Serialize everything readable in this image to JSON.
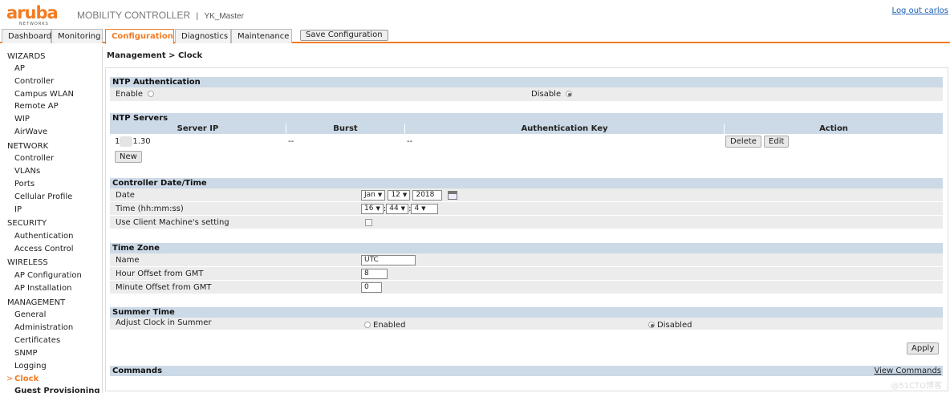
{
  "header": {
    "logo_text": "aruba",
    "logo_sub": "NETWORKS",
    "product": "MOBILITY CONTROLLER",
    "separator": "|",
    "host": "YK_Master",
    "logout": "Log out carlos"
  },
  "tabs": [
    "Dashboard",
    "Monitoring",
    "Configuration",
    "Diagnostics",
    "Maintenance"
  ],
  "save_button": "Save Configuration",
  "sidebar": {
    "wizards": "WIZARDS",
    "wizards_items": [
      "AP",
      "Controller",
      "Campus WLAN",
      "Remote AP",
      "WIP",
      "AirWave"
    ],
    "network": "NETWORK",
    "network_items": [
      "Controller",
      "VLANs",
      "Ports",
      "Cellular Profile",
      "IP"
    ],
    "security": "SECURITY",
    "security_items": [
      "Authentication",
      "Access Control"
    ],
    "wireless": "WIRELESS",
    "wireless_items": [
      "AP Configuration",
      "AP Installation"
    ],
    "management": "MANAGEMENT",
    "management_items": [
      "General",
      "Administration",
      "Certificates",
      "SNMP",
      "Logging",
      "Clock",
      "Guest Provisioning"
    ],
    "active_marker": ">"
  },
  "breadcrumb": "Management > Clock",
  "ntp_auth": {
    "title": "NTP Authentication",
    "enable_label": "Enable",
    "disable_label": "Disable",
    "selected": "Disable"
  },
  "ntp_servers": {
    "title": "NTP Servers",
    "columns": [
      "Server IP",
      "Burst",
      "Authentication Key",
      "Action"
    ],
    "rows": [
      {
        "server_ip_prefix": "1",
        "server_ip_suffix": "1.30",
        "burst": "--",
        "auth_key": "--",
        "delete": "Delete",
        "edit": "Edit"
      }
    ],
    "new_button": "New"
  },
  "datetime": {
    "title": "Controller Date/Time",
    "date_label": "Date",
    "month": "Jan",
    "day": "12",
    "year": "2018",
    "time_label": "Time (hh:mm:ss)",
    "hour": "16",
    "minute": "44",
    "second": "4",
    "colon": ":",
    "client_label": "Use Client Machine's setting",
    "client_checked": false
  },
  "timezone": {
    "title": "Time Zone",
    "name_label": "Name",
    "name_value": "UTC",
    "hour_label": "Hour Offset from GMT",
    "hour_value": "8",
    "minute_label": "Minute Offset from GMT",
    "minute_value": "0"
  },
  "summer": {
    "title": "Summer Time",
    "label": "Adjust Clock in Summer",
    "enabled": "Enabled",
    "disabled": "Disabled",
    "selected": "Disabled"
  },
  "apply_button": "Apply",
  "commands": {
    "title": "Commands",
    "link": "View Commands"
  },
  "watermark": "@51CTO博客",
  "colors": {
    "accent": "#f47b20",
    "section": "#ccd9e6",
    "row": "#ececec",
    "link": "#1a5fb4"
  }
}
